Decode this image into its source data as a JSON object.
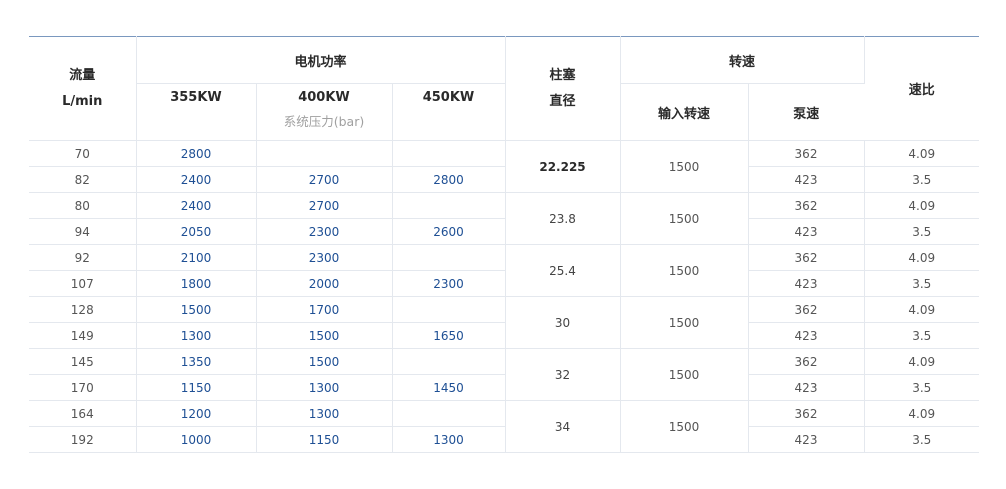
{
  "header": {
    "flow_line1": "流量",
    "flow_line2": "L/min",
    "motor_power": "电机功率",
    "p355": "355KW",
    "p400": "400KW",
    "p450": "450KW",
    "pressure_note": "系统压力(bar)",
    "plunger_line1": "柱塞",
    "plunger_line2": "直径",
    "speed": "转速",
    "input_speed": "输入转速",
    "pump_speed": "泵速",
    "ratio": "速比"
  },
  "rows": [
    {
      "flow": "70",
      "p355": "2800",
      "p400": "",
      "p450": "",
      "pump": "362",
      "ratio": "4.09"
    },
    {
      "flow": "82",
      "p355": "2400",
      "p400": "2700",
      "p450": "2800",
      "pump": "423",
      "ratio": "3.5"
    },
    {
      "flow": "80",
      "p355": "2400",
      "p400": "2700",
      "p450": "",
      "pump": "362",
      "ratio": "4.09"
    },
    {
      "flow": "94",
      "p355": "2050",
      "p400": "2300",
      "p450": "2600",
      "pump": "423",
      "ratio": "3.5"
    },
    {
      "flow": "92",
      "p355": "2100",
      "p400": "2300",
      "p450": "",
      "pump": "362",
      "ratio": "4.09"
    },
    {
      "flow": "107",
      "p355": "1800",
      "p400": "2000",
      "p450": "2300",
      "pump": "423",
      "ratio": "3.5"
    },
    {
      "flow": "128",
      "p355": "1500",
      "p400": "1700",
      "p450": "",
      "pump": "362",
      "ratio": "4.09"
    },
    {
      "flow": "149",
      "p355": "1300",
      "p400": "1500",
      "p450": "1650",
      "pump": "423",
      "ratio": "3.5"
    },
    {
      "flow": "145",
      "p355": "1350",
      "p400": "1500",
      "p450": "",
      "pump": "362",
      "ratio": "4.09"
    },
    {
      "flow": "170",
      "p355": "1150",
      "p400": "1300",
      "p450": "1450",
      "pump": "423",
      "ratio": "3.5"
    },
    {
      "flow": "164",
      "p355": "1200",
      "p400": "1300",
      "p450": "",
      "pump": "362",
      "ratio": "4.09"
    },
    {
      "flow": "192",
      "p355": "1000",
      "p400": "1150",
      "p450": "1300",
      "pump": "423",
      "ratio": "3.5"
    }
  ],
  "groups": [
    {
      "diameter": "22.225",
      "input_speed": "1500"
    },
    {
      "diameter": "23.8",
      "input_speed": "1500"
    },
    {
      "diameter": "25.4",
      "input_speed": "1500"
    },
    {
      "diameter": "30",
      "input_speed": "1500"
    },
    {
      "diameter": "32",
      "input_speed": "1500"
    },
    {
      "diameter": "34",
      "input_speed": "1500"
    }
  ]
}
